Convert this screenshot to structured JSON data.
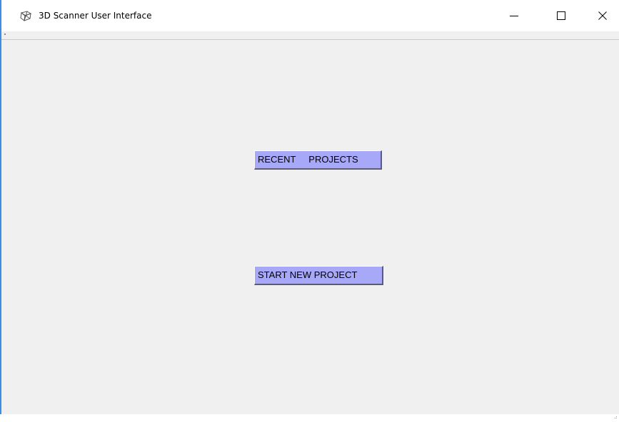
{
  "window": {
    "title": "3D Scanner User Interface",
    "app_icon": "cube-wireframe-icon",
    "controls": {
      "minimize_icon": "minimize-icon",
      "maximize_icon": "maximize-icon",
      "close_icon": "close-icon"
    },
    "accent_color": "#3c8ee0"
  },
  "main": {
    "recent_projects_label": "RECENT     PROJECTS",
    "start_new_project_label": "START NEW PROJECT",
    "button_color": "#a8a8f8",
    "background_color": "#f0f0f0"
  }
}
